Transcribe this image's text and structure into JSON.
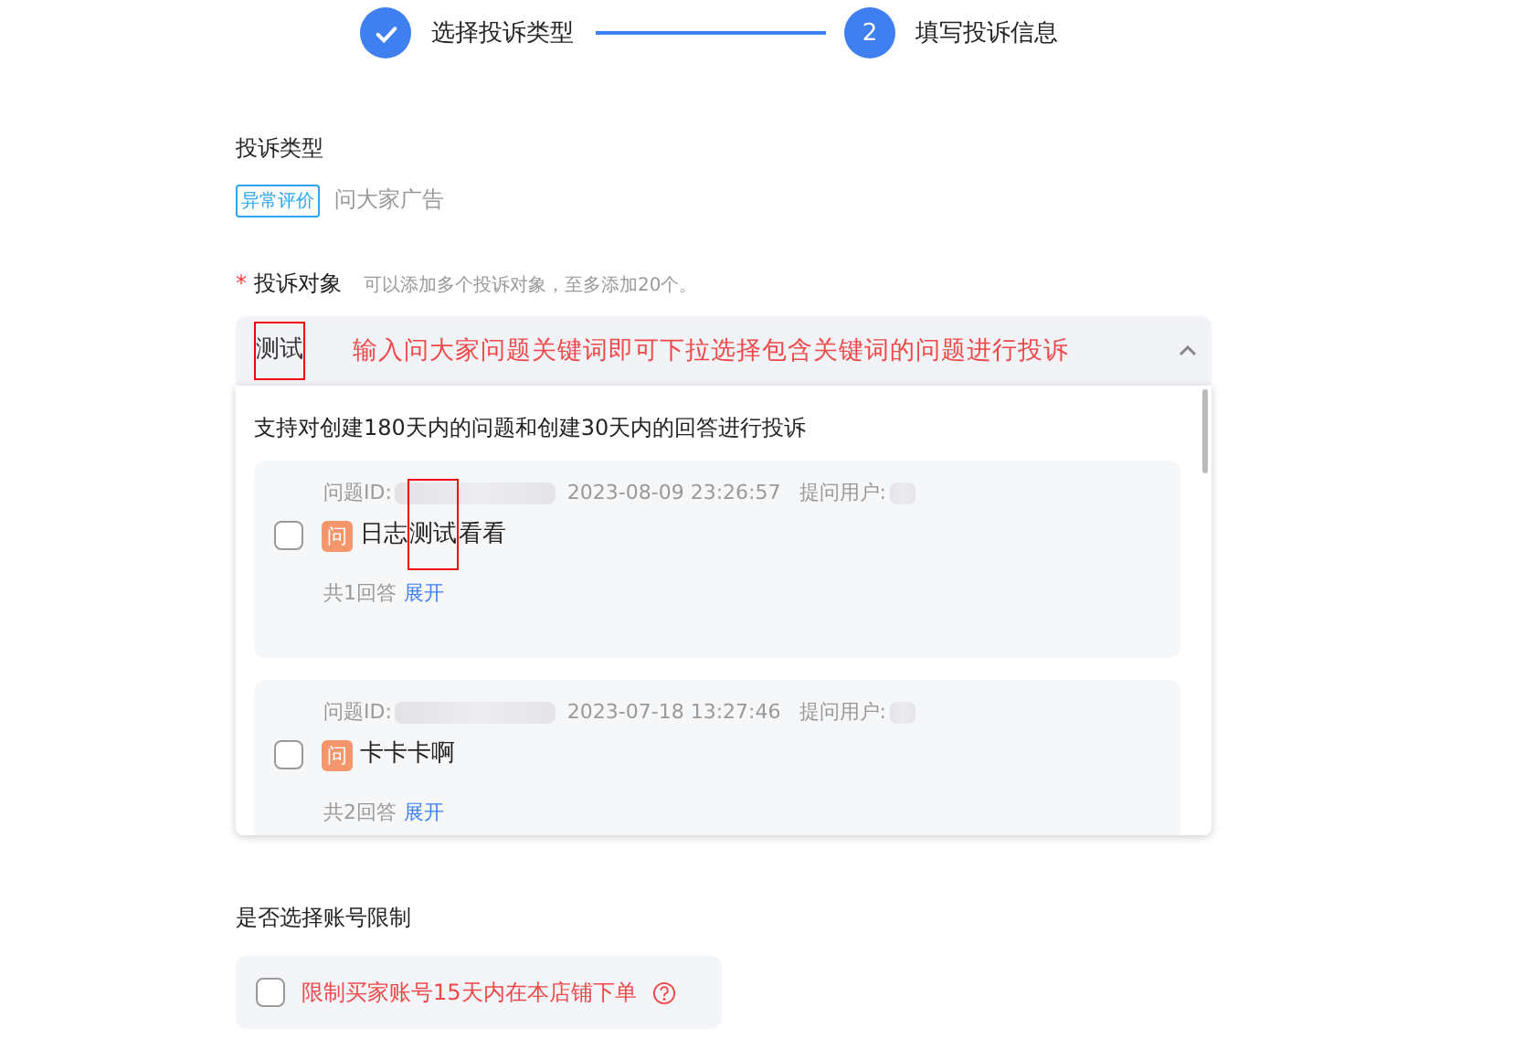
{
  "steps": [
    {
      "label": "选择投诉类型",
      "done": true
    },
    {
      "label": "填写投诉信息",
      "number": "2",
      "done": false
    }
  ],
  "complaint_type": {
    "label": "投诉类型",
    "tags": [
      {
        "label": "异常评价",
        "selected": true
      },
      {
        "label": "问大家广告",
        "selected": false
      }
    ]
  },
  "complaint_target": {
    "label": "投诉对象",
    "required_mark": "*",
    "hint": "可以添加多个投诉对象，至多添加20个。",
    "value": "测试",
    "annotation": "输入问大家问题关键词即可下拉选择包含关键词的问题进行投诉",
    "expanded": true,
    "dropdown": {
      "note": "支持对创建180天内的问题和创建30天内的回答进行投诉",
      "questions": [
        {
          "id_label": "问题ID:",
          "time": "2023-08-09 23:26:57",
          "user_label": "提问用户:",
          "badge": "问",
          "title_before": "日志",
          "title_marked": "测试",
          "title_after": "看看",
          "checked": false,
          "answers": "共1回答",
          "expand": "展开"
        },
        {
          "id_label": "问题ID:",
          "time": "2023-07-18 13:27:46",
          "user_label": "提问用户:",
          "badge": "问",
          "title_before": "卡卡卡啊",
          "checked": false,
          "answers": "共2回答",
          "expand": "展开"
        }
      ]
    }
  },
  "account_limit": {
    "label": "是否选择账号限制",
    "option": "限制买家账号15天内在本店铺下单",
    "checked": false
  }
}
